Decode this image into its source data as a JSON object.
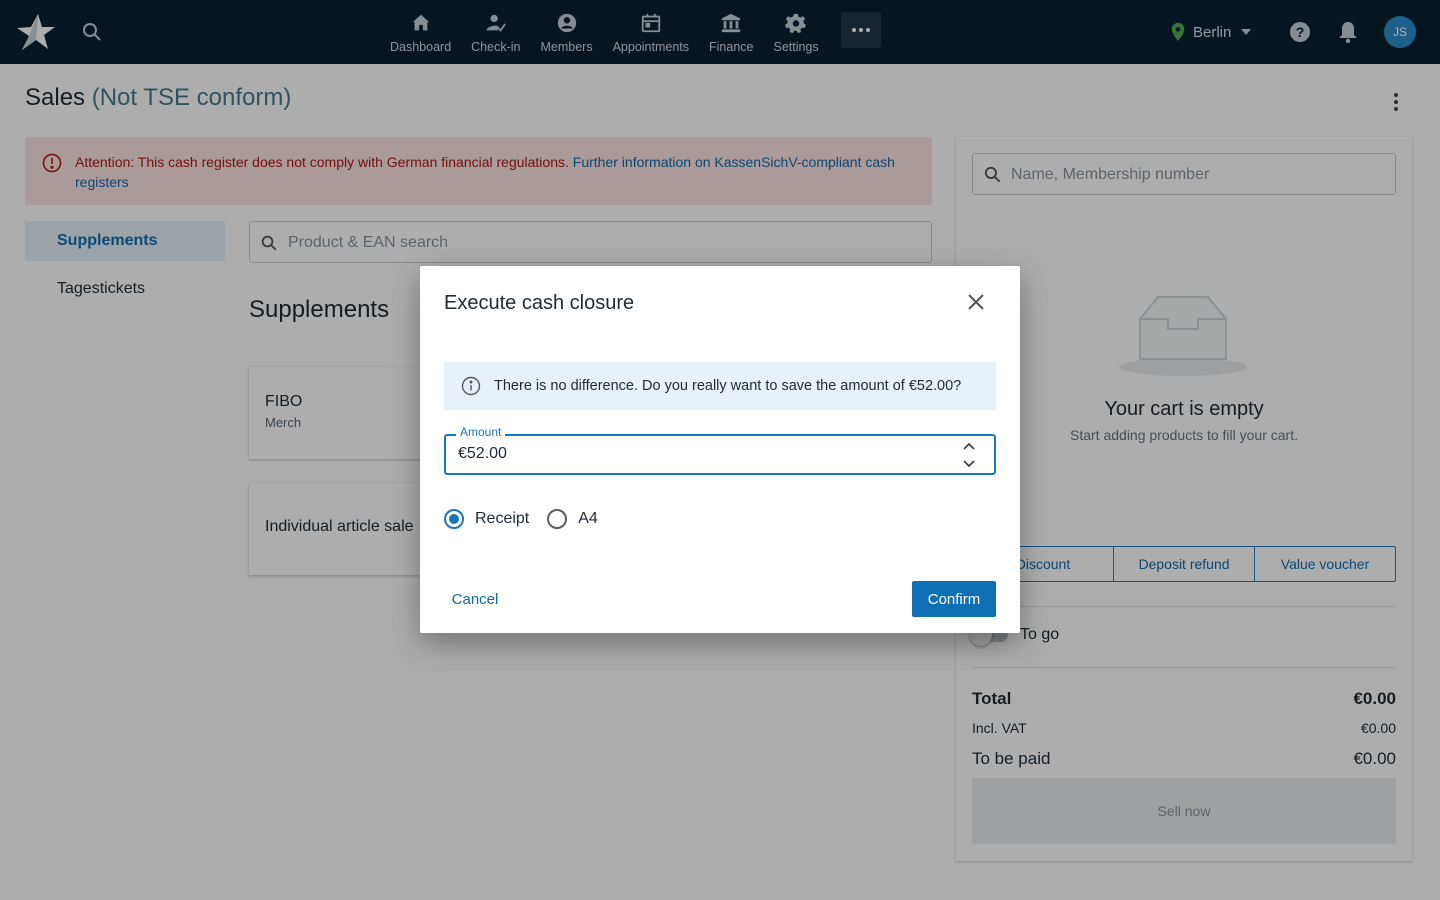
{
  "nav": {
    "items": [
      {
        "label": "Dashboard",
        "icon": "home-icon"
      },
      {
        "label": "Check-in",
        "icon": "check-in-icon"
      },
      {
        "label": "Members",
        "icon": "members-icon"
      },
      {
        "label": "Appointments",
        "icon": "calendar-icon"
      },
      {
        "label": "Finance",
        "icon": "bank-icon"
      },
      {
        "label": "Settings",
        "icon": "gear-icon"
      }
    ],
    "location": "Berlin",
    "avatar_initials": "JS"
  },
  "page": {
    "title": "Sales",
    "title_suffix": "(Not TSE conform)"
  },
  "alert": {
    "text": "Attention: This cash register does not comply with German financial regulations.",
    "link": "Further information on KassenSichV-compliant cash registers"
  },
  "categories": [
    {
      "label": "Supplements",
      "active": true
    },
    {
      "label": "Tagestickets",
      "active": false
    }
  ],
  "product_search": {
    "placeholder": "Product & EAN search"
  },
  "section_title": "Supplements",
  "products": [
    {
      "name": "FIBO",
      "sub": "Merch"
    },
    {
      "name": "Individual article sale",
      "sub": ""
    }
  ],
  "cart": {
    "search_placeholder": "Name, Membership number",
    "empty_title": "Your cart is empty",
    "empty_sub": "Start adding products to fill your cart.",
    "actions": [
      "Discount",
      "Deposit refund",
      "Value voucher"
    ],
    "to_go_label": "To go",
    "total_label": "Total",
    "total_value": "€0.00",
    "vat_label": "Incl. VAT",
    "vat_value": "€0.00",
    "paid_label": "To be paid",
    "paid_value": "€0.00",
    "sell_label": "Sell now"
  },
  "dialog": {
    "title": "Execute cash closure",
    "info": "There is no difference. Do you really want to save the amount of €52.00?",
    "amount_label": "Amount",
    "amount_value": "€52.00",
    "options": [
      "Receipt",
      "A4"
    ],
    "selected_option": "Receipt",
    "cancel": "Cancel",
    "confirm": "Confirm"
  },
  "colors": {
    "topbar": "#0b2031",
    "accent": "#0f6fb5",
    "alert_bg": "#fde3e3",
    "alert_text": "#b01a1a",
    "location_pin": "#4caf50"
  }
}
